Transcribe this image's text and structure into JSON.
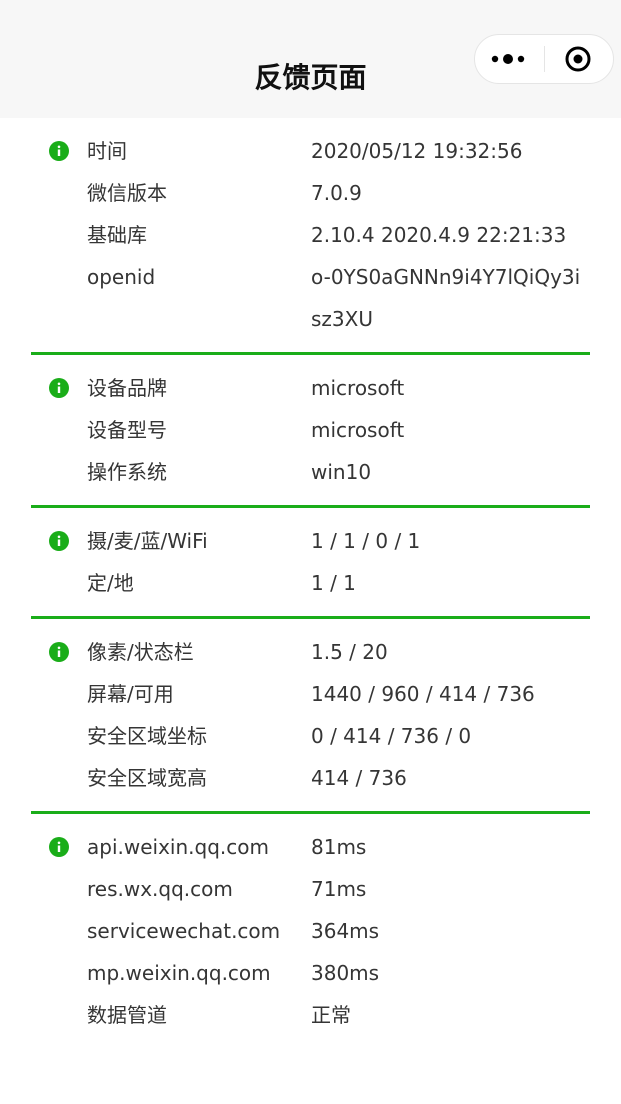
{
  "nav": {
    "title": "反馈页面",
    "icons": {
      "more": "more-dots-icon",
      "close": "target-close-icon"
    }
  },
  "colors": {
    "accent": "#1aad19",
    "text": "#353535",
    "nav_bg": "#f7f7f7"
  },
  "sections": [
    {
      "rows": [
        {
          "label": "时间",
          "value": "2020/05/12 19:32:56"
        },
        {
          "label": "微信版本",
          "value": "7.0.9"
        },
        {
          "label": "基础库",
          "value": "2.10.4 2020.4.9 22:21:33"
        },
        {
          "label": "openid",
          "value": "o-0YS0aGNNn9i4Y7lQiQy3isz3XU"
        }
      ]
    },
    {
      "rows": [
        {
          "label": "设备品牌",
          "value": "microsoft"
        },
        {
          "label": "设备型号",
          "value": "microsoft"
        },
        {
          "label": "操作系统",
          "value": "win10"
        }
      ]
    },
    {
      "rows": [
        {
          "label": "摄/麦/蓝/WiFi",
          "value": "1 / 1 / 0 / 1"
        },
        {
          "label": "定/地",
          "value": "1 / 1"
        }
      ]
    },
    {
      "rows": [
        {
          "label": "像素/状态栏",
          "value": "1.5 / 20"
        },
        {
          "label": "屏幕/可用",
          "value": "1440 / 960 / 414 / 736"
        },
        {
          "label": "安全区域坐标",
          "value": "0 / 414 / 736 / 0"
        },
        {
          "label": "安全区域宽高",
          "value": "414 / 736"
        }
      ]
    },
    {
      "rows": [
        {
          "label": "api.weixin.qq.com",
          "value": "81ms"
        },
        {
          "label": "res.wx.qq.com",
          "value": "71ms"
        },
        {
          "label": "servicewechat.com",
          "value": "364ms"
        },
        {
          "label": "mp.weixin.qq.com",
          "value": "380ms"
        },
        {
          "label": "数据管道",
          "value": "正常"
        }
      ]
    }
  ]
}
